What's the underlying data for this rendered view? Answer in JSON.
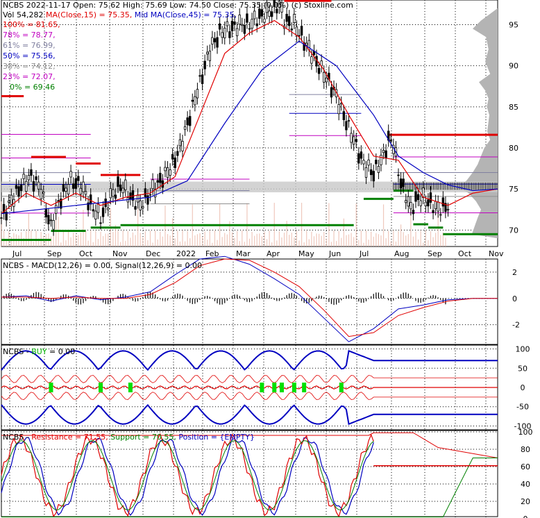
{
  "chart_data": [
    {
      "type": "candlestick",
      "ticker": "NCBS",
      "header": {
        "title": "NCBS  2022-11-17 Open: 75.62  High: 75.69  Low: 74.50  Close: 75.35 (0.0%)  (c) Stoxline.com",
        "volume": "Vol 54,282",
        "ma15": "MA(Close,15) = 75.35,",
        "ma45": "Mid MA(Close,45) = 75.35,"
      },
      "fib_levels": [
        {
          "label": "100% = 81.65,",
          "value": 81.65,
          "color": "#e00000"
        },
        {
          "label": "78% = 78.77,",
          "value": 78.77,
          "color": "#c000c0"
        },
        {
          "label": "61% = 76.99,",
          "value": 76.99,
          "color": "#8080a0"
        },
        {
          "label": "50% = 75.56,",
          "value": 75.56,
          "color": "#0000c0"
        },
        {
          "label": "38% = 74.12,",
          "value": 74.12,
          "color": "#909090"
        },
        {
          "label": "23% = 72.07,",
          "value": 72.07,
          "color": "#c000c0"
        },
        {
          "label": "0% = 69.46",
          "value": 69.46,
          "color": "#008000"
        }
      ],
      "x_ticks": [
        "Jul",
        "Sep",
        "Oct",
        "Nov",
        "Dec",
        "2022",
        "Feb",
        "Mar",
        "Apr",
        "May",
        "Jun",
        "Jul",
        "Aug",
        "Sep",
        "Oct",
        "Nov"
      ],
      "y_ticks": [
        95,
        90,
        85,
        80,
        75,
        70
      ],
      "ylim": [
        68,
        98
      ],
      "price_path": [
        [
          0,
          71.5
        ],
        [
          4,
          73.5
        ],
        [
          8,
          75.5
        ],
        [
          12,
          76.5
        ],
        [
          16,
          75
        ],
        [
          18,
          72.5
        ],
        [
          20,
          70.5
        ],
        [
          24,
          74
        ],
        [
          28,
          76
        ],
        [
          32,
          75.5
        ],
        [
          36,
          73
        ],
        [
          40,
          71.5
        ],
        [
          44,
          74
        ],
        [
          48,
          75.5
        ],
        [
          52,
          74
        ],
        [
          56,
          73
        ],
        [
          60,
          74.5
        ],
        [
          64,
          76
        ],
        [
          68,
          77.5
        ],
        [
          72,
          80
        ],
        [
          76,
          84
        ],
        [
          80,
          88
        ],
        [
          84,
          92
        ],
        [
          88,
          94
        ],
        [
          92,
          94.5
        ],
        [
          96,
          95
        ],
        [
          100,
          95
        ],
        [
          104,
          96
        ],
        [
          108,
          96.5
        ],
        [
          112,
          97.5
        ],
        [
          114,
          95.5
        ],
        [
          118,
          95
        ],
        [
          122,
          93
        ],
        [
          126,
          91
        ],
        [
          130,
          89
        ],
        [
          134,
          87
        ],
        [
          138,
          84
        ],
        [
          142,
          81
        ],
        [
          146,
          78
        ],
        [
          150,
          77
        ],
        [
          154,
          79
        ],
        [
          156,
          81
        ],
        [
          158,
          80.5
        ],
        [
          160,
          77
        ],
        [
          162,
          75
        ],
        [
          165,
          72.5
        ],
        [
          168,
          74
        ],
        [
          172,
          73.5
        ],
        [
          176,
          72.5
        ],
        [
          180,
          73
        ]
      ],
      "ma15_path": [
        [
          0,
          72
        ],
        [
          10,
          74.5
        ],
        [
          20,
          73
        ],
        [
          30,
          74.5
        ],
        [
          40,
          73
        ],
        [
          50,
          74
        ],
        [
          60,
          74.5
        ],
        [
          70,
          76.5
        ],
        [
          80,
          84
        ],
        [
          90,
          91.5
        ],
        [
          100,
          94
        ],
        [
          110,
          95.5
        ],
        [
          120,
          93.5
        ],
        [
          130,
          89.5
        ],
        [
          140,
          84
        ],
        [
          150,
          79
        ],
        [
          160,
          78.5
        ],
        [
          170,
          74
        ],
        [
          180,
          73
        ],
        [
          190,
          74.5
        ],
        [
          200,
          75
        ]
      ],
      "ma45_path": [
        [
          0,
          72
        ],
        [
          15,
          72.5
        ],
        [
          30,
          73
        ],
        [
          45,
          73.5
        ],
        [
          60,
          74
        ],
        [
          75,
          76
        ],
        [
          90,
          83
        ],
        [
          105,
          89.5
        ],
        [
          120,
          93
        ],
        [
          135,
          90
        ],
        [
          150,
          84
        ],
        [
          160,
          79
        ],
        [
          170,
          77
        ],
        [
          180,
          75.5
        ],
        [
          190,
          74.8
        ],
        [
          200,
          75
        ]
      ],
      "volume_profile": [
        [
          95.5,
          40
        ],
        [
          94.5,
          60
        ],
        [
          93.5,
          28
        ],
        [
          92,
          22
        ],
        [
          90.5,
          30
        ],
        [
          89,
          18
        ],
        [
          88,
          45
        ],
        [
          87,
          30
        ],
        [
          86,
          22
        ],
        [
          85,
          26
        ],
        [
          84,
          20
        ],
        [
          82,
          25
        ],
        [
          81,
          18
        ],
        [
          80,
          32
        ],
        [
          79,
          40
        ],
        [
          78,
          48
        ],
        [
          77,
          60
        ],
        [
          76,
          75
        ],
        [
          75.3,
          95
        ],
        [
          74.5,
          70
        ],
        [
          73.5,
          52
        ],
        [
          72.5,
          40
        ],
        [
          71.5,
          48
        ],
        [
          70.5,
          55
        ],
        [
          69.5,
          62
        ]
      ]
    },
    {
      "type": "line",
      "label": "NCBS - MACD(12,26) = 0.00, Signal(12,26,9) = 0.00",
      "y_ticks": [
        2,
        0,
        -2
      ],
      "ylim": [
        -3.5,
        3.0
      ],
      "series": [
        {
          "name": "MACD(12,26)",
          "color": "#0000c0",
          "points": [
            [
              0,
              0.1
            ],
            [
              10,
              0.2
            ],
            [
              20,
              -0.2
            ],
            [
              30,
              0.2
            ],
            [
              40,
              -0.1
            ],
            [
              50,
              0.1
            ],
            [
              60,
              0.5
            ],
            [
              70,
              1.8
            ],
            [
              80,
              3.0
            ],
            [
              90,
              3.2
            ],
            [
              100,
              2.6
            ],
            [
              110,
              1.5
            ],
            [
              120,
              0.3
            ],
            [
              130,
              -1.5
            ],
            [
              140,
              -3.3
            ],
            [
              150,
              -2.3
            ],
            [
              160,
              -0.8
            ],
            [
              170,
              -0.5
            ],
            [
              180,
              -0.1
            ],
            [
              190,
              0
            ],
            [
              200,
              0
            ]
          ]
        },
        {
          "name": "Signal(12,26,9)",
          "color": "#e00000",
          "points": [
            [
              0,
              0.1
            ],
            [
              10,
              0.1
            ],
            [
              20,
              0
            ],
            [
              30,
              0.1
            ],
            [
              40,
              0
            ],
            [
              50,
              0
            ],
            [
              60,
              0.3
            ],
            [
              70,
              1.2
            ],
            [
              80,
              2.5
            ],
            [
              90,
              3.0
            ],
            [
              100,
              2.9
            ],
            [
              110,
              2.0
            ],
            [
              120,
              0.9
            ],
            [
              130,
              -0.9
            ],
            [
              140,
              -2.9
            ],
            [
              150,
              -2.6
            ],
            [
              160,
              -1.3
            ],
            [
              170,
              -0.7
            ],
            [
              180,
              -0.2
            ],
            [
              190,
              0
            ],
            [
              200,
              0
            ]
          ]
        }
      ]
    },
    {
      "type": "line",
      "label_prefix": "NCBS - ",
      "label_buy": "BUY",
      "label_suffix": " = 0.00",
      "y_ticks": [
        100,
        50,
        0,
        -50,
        -100
      ],
      "ylim": [
        -110,
        110
      ],
      "buy_markers": [
        20,
        40,
        52,
        105,
        110,
        113,
        118,
        122,
        137
      ]
    },
    {
      "type": "line",
      "label_prefix": "NCBS - ",
      "label_resistance": "Resistance = 71.55,",
      "label_support": "Support = 70.55,",
      "label_position": "Position = {EMPTY}",
      "y_ticks": [
        100,
        80,
        60,
        40,
        20,
        0
      ],
      "ylim": [
        0,
        100
      ],
      "series": [
        {
          "name": "Resistance",
          "color": "#e00000"
        },
        {
          "name": "Support",
          "color": "#008000"
        },
        {
          "name": "Position",
          "color": "#0000c0"
        }
      ]
    }
  ]
}
